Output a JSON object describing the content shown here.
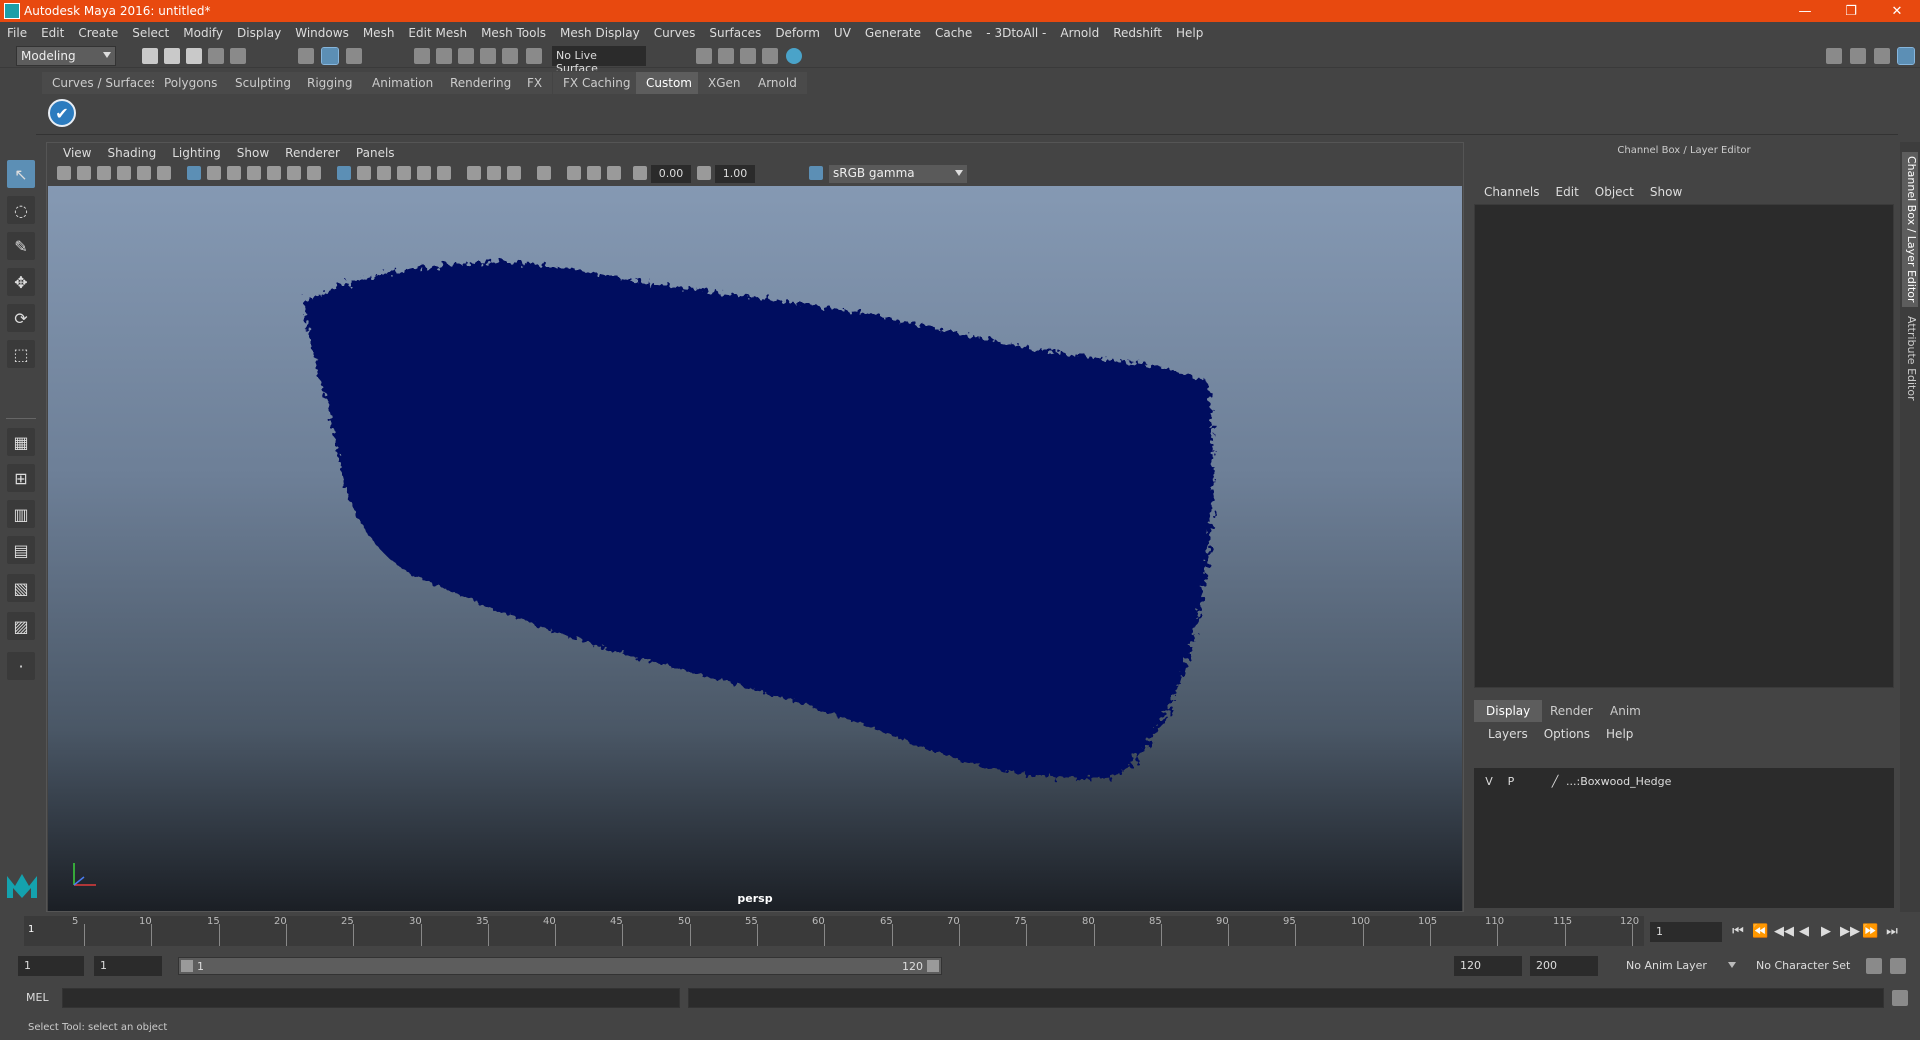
{
  "window": {
    "title": "Autodesk Maya 2016: untitled*",
    "minimize": "—",
    "maximize": "❐",
    "close": "✕"
  },
  "menu": [
    "File",
    "Edit",
    "Create",
    "Select",
    "Modify",
    "Display",
    "Windows",
    "Mesh",
    "Edit Mesh",
    "Mesh Tools",
    "Mesh Display",
    "Curves",
    "Surfaces",
    "Deform",
    "UV",
    "Generate",
    "Cache",
    "- 3DtoAll -",
    "Arnold",
    "Redshift",
    "Help"
  ],
  "status": {
    "mode": "Modeling",
    "live_surface": "No Live Surface"
  },
  "shelf": {
    "tabs": [
      "Curves / Surfaces",
      "Polygons",
      "Sculpting",
      "Rigging",
      "Animation",
      "Rendering",
      "FX",
      "FX Caching",
      "Custom",
      "XGen",
      "Arnold"
    ],
    "active_tab": "Custom",
    "button_glyph": "✔"
  },
  "viewport": {
    "menu": [
      "View",
      "Shading",
      "Lighting",
      "Show",
      "Renderer",
      "Panels"
    ],
    "exposure": "0.00",
    "gamma_value": "1.00",
    "color_space": "sRGB gamma",
    "camera": "persp",
    "object_color": "#000a5e"
  },
  "channel_box": {
    "title": "Channel Box / Layer Editor",
    "menu": [
      "Channels",
      "Edit",
      "Object",
      "Show"
    ],
    "layer_tabs": [
      "Display",
      "Render",
      "Anim"
    ],
    "layer_menu": [
      "Layers",
      "Options",
      "Help"
    ],
    "layers": [
      {
        "v": "V",
        "p": "P",
        "name": "...:Boxwood_Hedge"
      }
    ]
  },
  "side_tabs": [
    "Channel Box / Layer Editor",
    "Attribute Editor"
  ],
  "timeline": {
    "ticks": [
      "5",
      "10",
      "15",
      "20",
      "25",
      "30",
      "35",
      "40",
      "45",
      "50",
      "55",
      "60",
      "65",
      "70",
      "75",
      "80",
      "85",
      "90",
      "95",
      "100",
      "105",
      "110",
      "115",
      "120"
    ],
    "current_marker": "1",
    "current_frame": "1",
    "playback": [
      "⏮",
      "⏪",
      "◀◀",
      "◀",
      "▶",
      "▶▶",
      "⏩",
      "⏭"
    ]
  },
  "range": {
    "start": "1",
    "playback_start": "1",
    "slider_start": "1",
    "slider_end": "120",
    "playback_end": "120",
    "end": "200",
    "anim_layer": "No Anim Layer",
    "character_set": "No Character Set"
  },
  "command": {
    "label": "MEL",
    "help": "Select Tool: select an object"
  }
}
